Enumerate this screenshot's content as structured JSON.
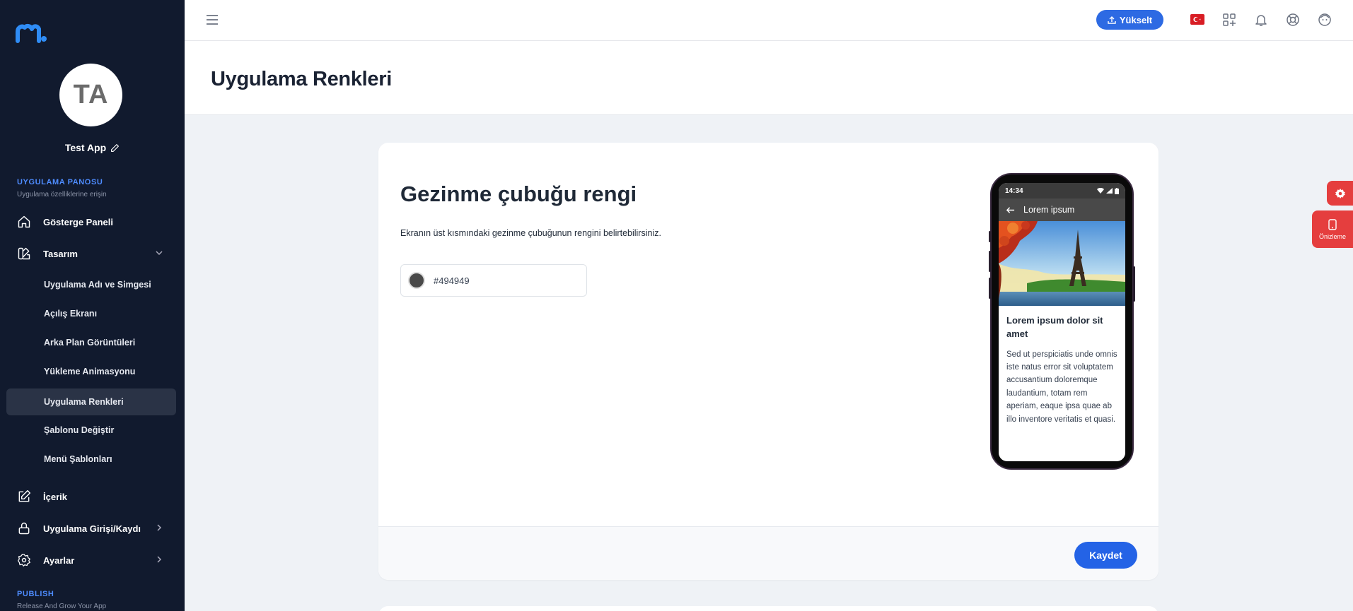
{
  "sidebar": {
    "logo": "mobiroller-logo",
    "avatar_initials": "TA",
    "app_name": "Test App",
    "section_dashboard": {
      "title": "UYGULAMA PANOSU",
      "subtitle": "Uygulama özelliklerine erişin"
    },
    "items": [
      {
        "label": "Gösterge Paneli",
        "icon": "home-icon"
      },
      {
        "label": "Tasarım",
        "icon": "design-icon",
        "expanded": true
      },
      {
        "label": "İçerik",
        "icon": "edit-icon"
      },
      {
        "label": "Uygulama Girişi/Kaydı",
        "icon": "lock-icon"
      },
      {
        "label": "Ayarlar",
        "icon": "gear-icon"
      }
    ],
    "design_subitems": [
      {
        "label": "Uygulama Adı ve Simgesi"
      },
      {
        "label": "Açılış Ekranı"
      },
      {
        "label": "Arka Plan Görüntüleri"
      },
      {
        "label": "Yükleme Animasyonu"
      },
      {
        "label": "Uygulama Renkleri",
        "active": true
      },
      {
        "label": "Şablonu Değiştir"
      },
      {
        "label": "Menü Şablonları"
      }
    ],
    "section_publish": {
      "title": "PUBLISH",
      "subtitle": "Release And Grow Your App"
    }
  },
  "topbar": {
    "upgrade_label": "Yükselt",
    "language_flag": "turkey-flag"
  },
  "page": {
    "title": "Uygulama Renkleri"
  },
  "card": {
    "title": "Gezinme çubuğu rengi",
    "description": "Ekranın üst kısmındaki gezinme çubuğunun rengini belirtebilirsiniz.",
    "color_value": "#494949",
    "save_label": "Kaydet"
  },
  "preview": {
    "time": "14:34",
    "nav_title": "Lorem ipsum",
    "heading": "Lorem ipsum dolor sit amet",
    "body": "Sed ut perspiciatis unde omnis iste natus error sit voluptatem accusantium doloremque laudantium, totam rem aperiam, eaque ipsa quae ab illo inventore veritatis et quasi."
  },
  "floating": {
    "preview_label": "Önizleme"
  },
  "colors": {
    "sidebar_bg": "#111a2e",
    "accent": "#2d6ae3",
    "section_title": "#4e8cff",
    "navbar_color": "#494949",
    "fab_red": "#e53e3e"
  }
}
